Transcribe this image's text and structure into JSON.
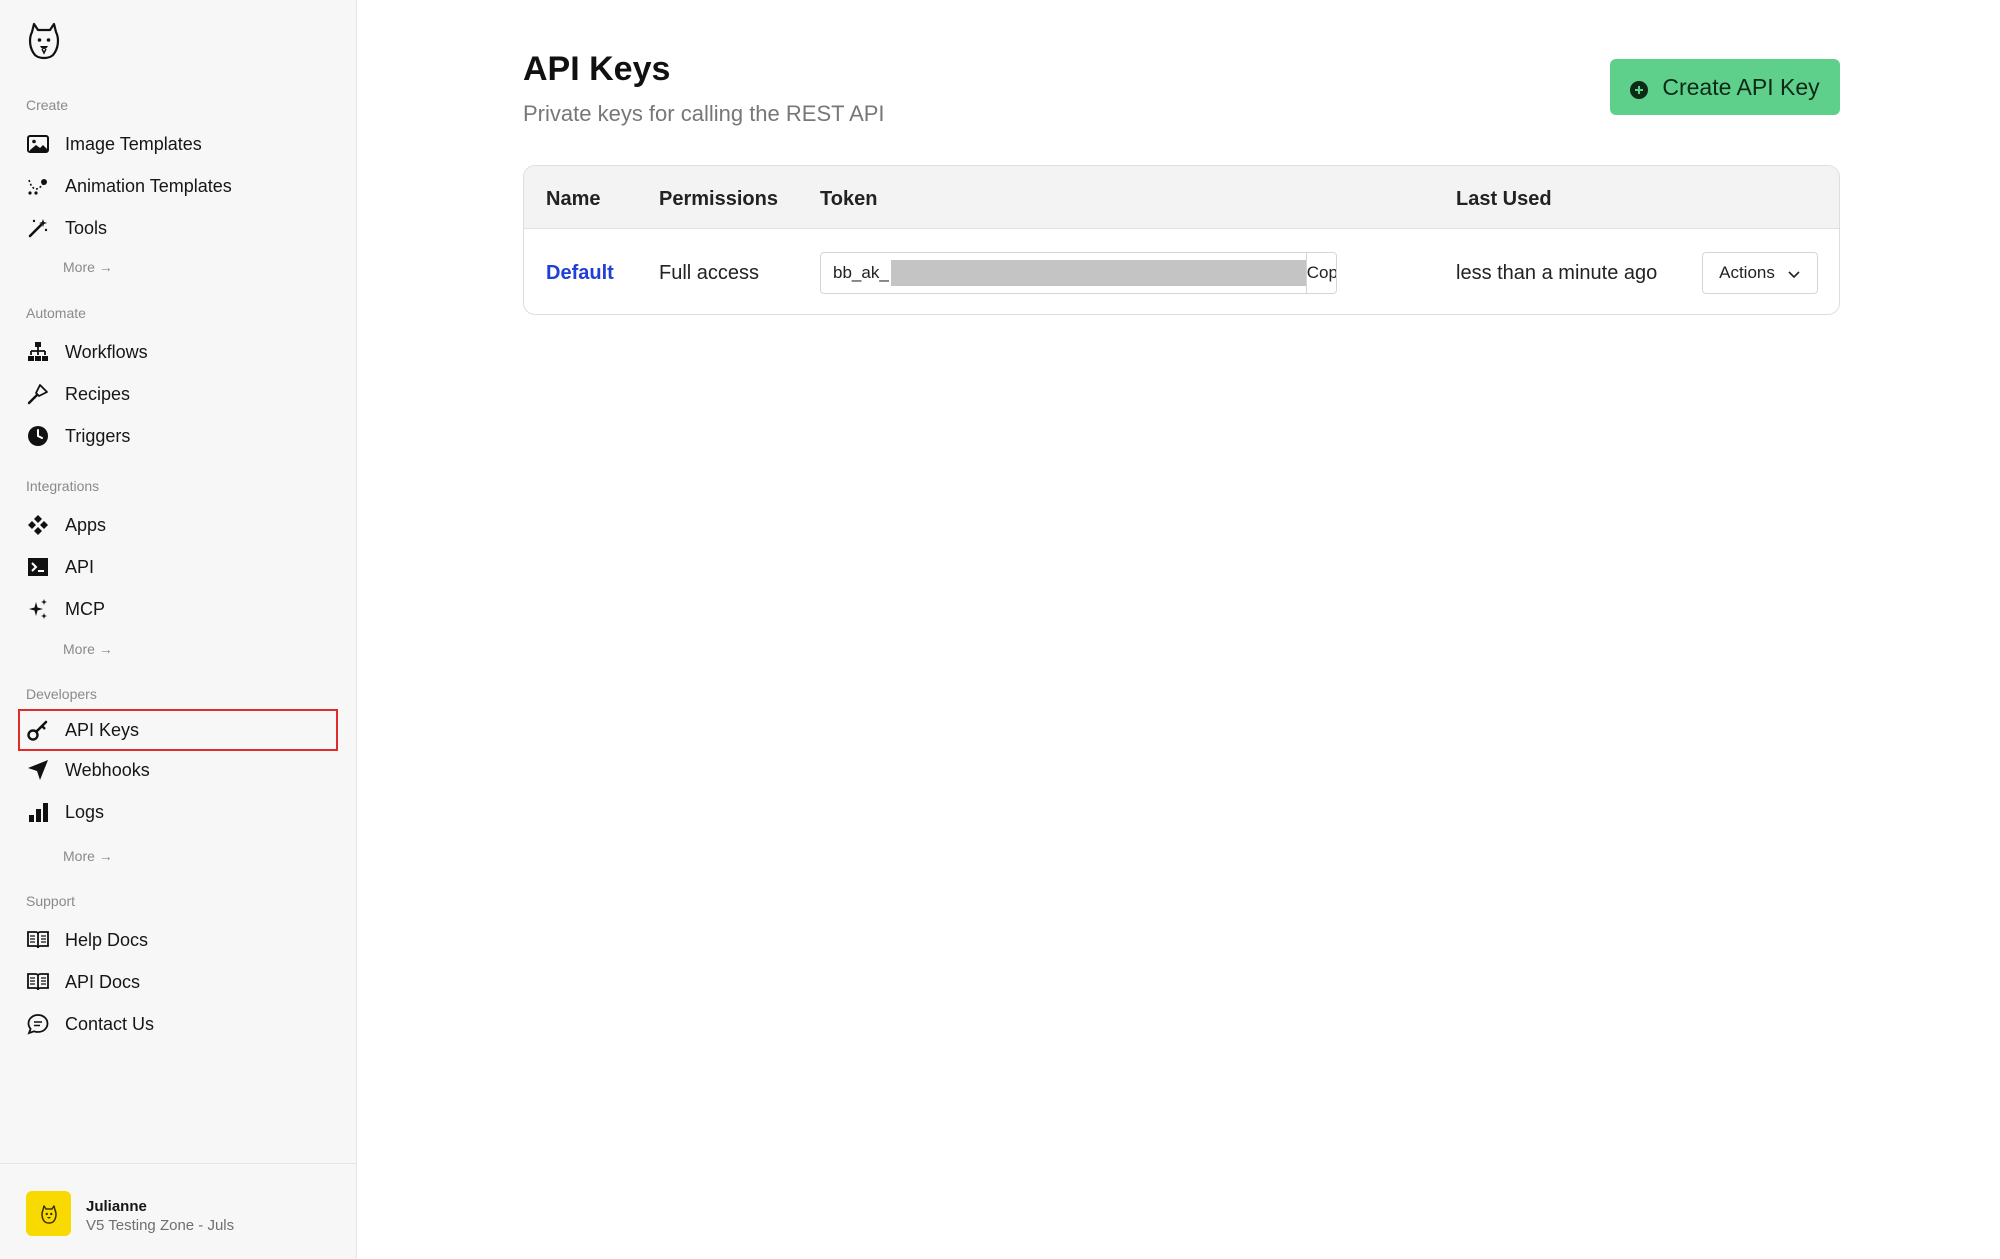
{
  "sidebar": {
    "sections": {
      "create": "Create",
      "automate": "Automate",
      "integrations": "Integrations",
      "developers": "Developers",
      "support": "Support"
    },
    "items": {
      "image_templates": "Image Templates",
      "animation_templates": "Animation Templates",
      "tools": "Tools",
      "workflows": "Workflows",
      "recipes": "Recipes",
      "triggers": "Triggers",
      "apps": "Apps",
      "api": "API",
      "mcp": "MCP",
      "api_keys": "API Keys",
      "webhooks": "Webhooks",
      "logs": "Logs",
      "help_docs": "Help Docs",
      "api_docs": "API Docs",
      "contact_us": "Contact Us"
    },
    "more_label": "More →",
    "active_item": "api_keys",
    "user": {
      "name": "Julianne",
      "org": "V5 Testing Zone - Juls"
    }
  },
  "main": {
    "title": "API Keys",
    "subtitle": "Private keys for calling the REST API",
    "create_button": "Create API Key",
    "table": {
      "headers": [
        "Name",
        "Permissions",
        "Token",
        "Last Used"
      ],
      "rows": [
        {
          "name": "Default",
          "permissions": "Full access",
          "token_prefix": "bb_ak_",
          "copy_label": "Copy",
          "last_used": "less than a minute ago",
          "actions_label": "Actions"
        }
      ]
    }
  },
  "colors": {
    "accent_green": "#5fcf8c",
    "link_blue": "#1f3fd6",
    "highlight_red": "#e02b2b",
    "avatar_yellow": "#f8d900"
  }
}
